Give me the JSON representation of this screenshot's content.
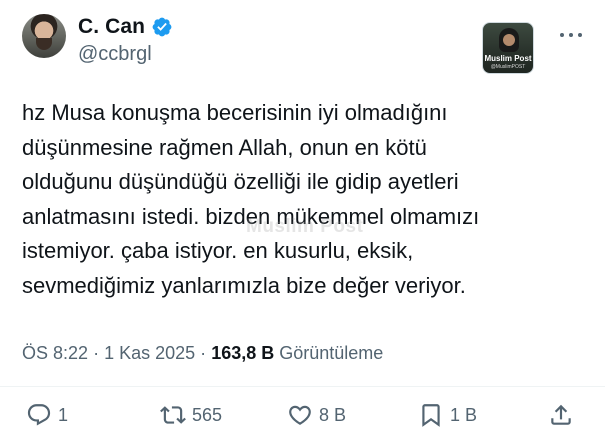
{
  "author": {
    "name": "C. Can",
    "handle": "@ccbrgl",
    "verified": true
  },
  "brand_logo": {
    "title": "Muslim Post",
    "subtitle": "@MuslimPOST"
  },
  "tweet": {
    "lines": [
      "hz Musa konuşma becerisinin iyi olmadığını",
      "düşünmesine rağmen Allah, onun en kötü",
      "olduğunu düşündüğü özelliği ile gidip ayetleri",
      "anlatmasını istedi. bizden mükemmel olmamızı",
      "istemiyor. çaba istiyor. en kusurlu, eksik,",
      "sevmediğimiz yanlarımızla bize değer veriyor."
    ],
    "watermark": "Muslim Post"
  },
  "meta": {
    "time": "ÖS 8:22",
    "separator": "·",
    "date": "1 Kas 2025",
    "views_count": "163,8 B",
    "views_label": "Görüntüleme"
  },
  "actions": {
    "replies": "1",
    "reposts": "565",
    "likes": "8 B",
    "bookmarks": "1 B"
  },
  "icons": {
    "verified": "verified-badge-icon",
    "more": "more-options-icon",
    "reply": "reply-icon",
    "repost": "repost-icon",
    "like": "heart-icon",
    "bookmark": "bookmark-icon",
    "share": "share-icon"
  },
  "colors": {
    "text": "#0f1419",
    "secondary": "#536471",
    "verified": "#1d9bf0",
    "divider": "#eff3f4"
  }
}
